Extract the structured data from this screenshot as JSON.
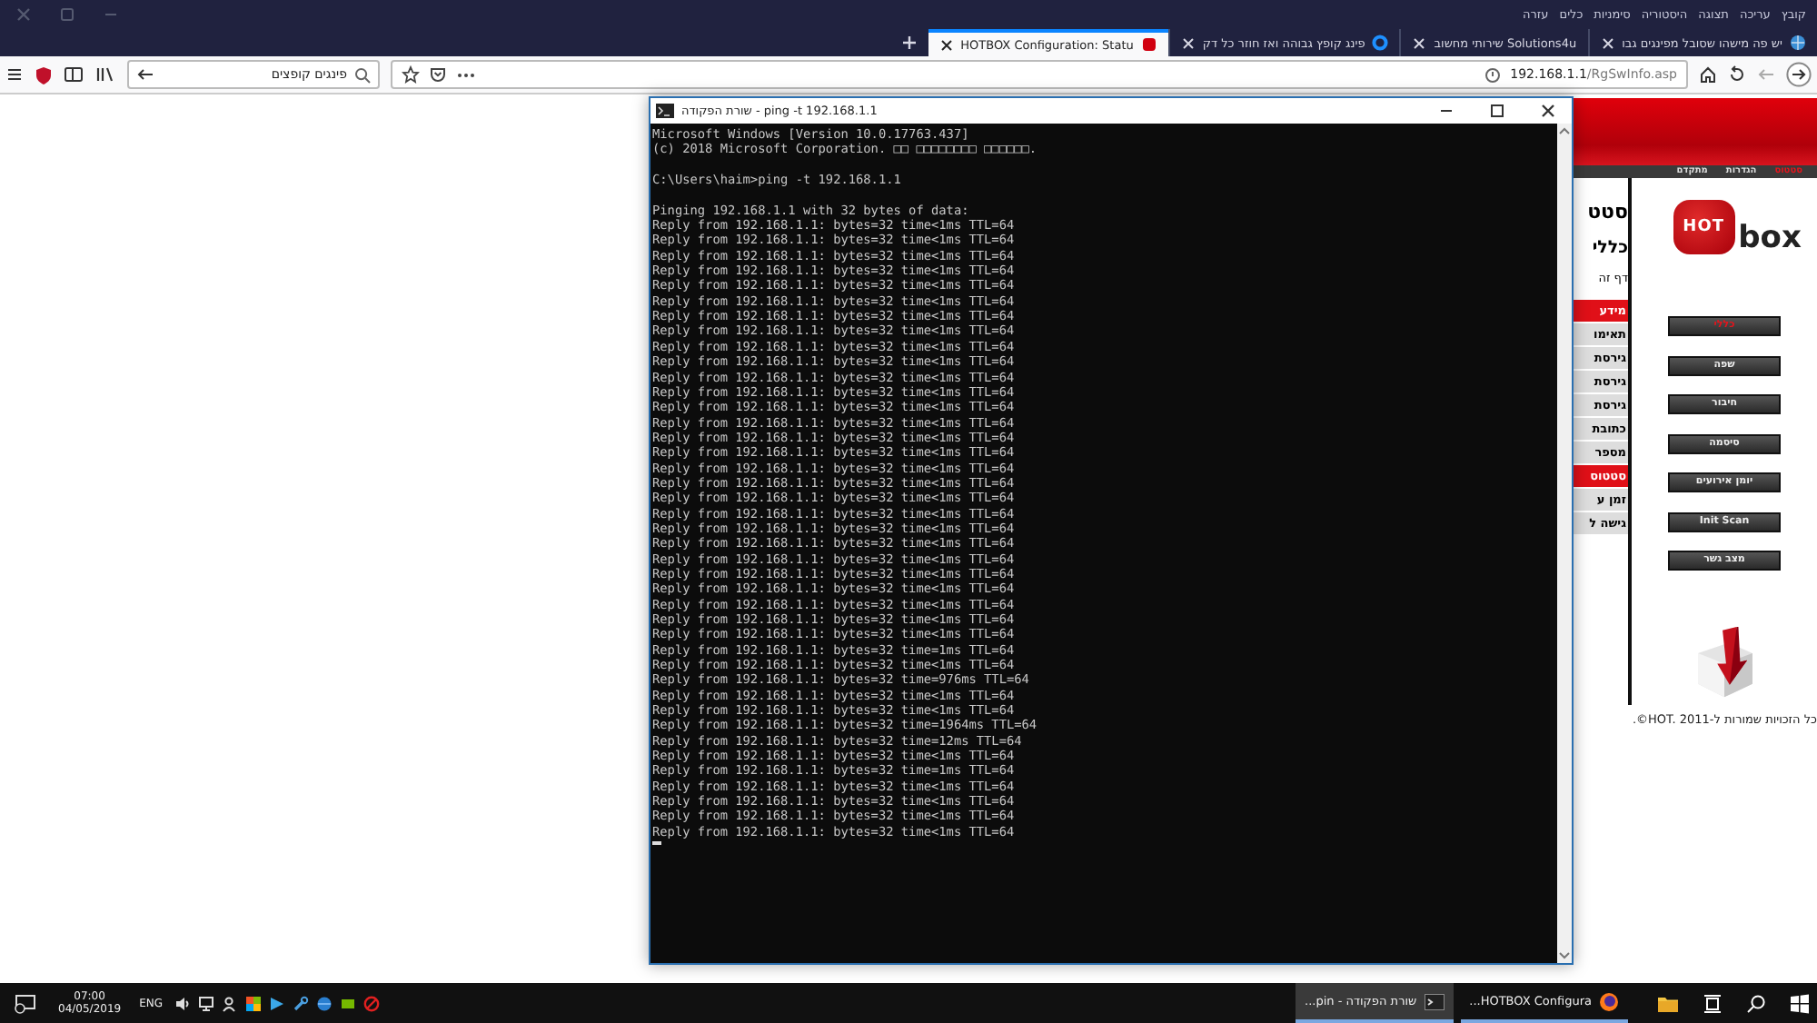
{
  "browser": {
    "menu": [
      "קובץ",
      "עריכה",
      "תצוגה",
      "היסטוריה",
      "סימניות",
      "כלים",
      "עזרה"
    ],
    "tabs": [
      {
        "title": "יש פה מישהו שסובל מפינגים גבו",
        "kind": "globe",
        "selected": false
      },
      {
        "title": "Solutions4u שירותי מחשוב",
        "kind": "none",
        "selected": false
      },
      {
        "title": "פינג קופץ גבוהה ואז חוזר כל דק",
        "kind": "ring",
        "selected": false
      },
      {
        "title": "HOTBOX Configuration: Statu",
        "kind": "square",
        "selected": true
      }
    ],
    "url_host": "192.168.1.1",
    "url_path": "/RgSwInfo.asp",
    "search": "פינגים קופצים"
  },
  "page": {
    "top_nav": [
      {
        "label": "סטטוס",
        "selected": true
      },
      {
        "label": "הגדרות",
        "selected": false
      },
      {
        "label": "מתקדם",
        "selected": false
      }
    ],
    "heading": "סטט",
    "subheading": "כללי",
    "intro": "דף זה",
    "table_rows": [
      {
        "label": "מידע",
        "highlighted": true
      },
      {
        "label": "תאימו",
        "highlighted": false
      },
      {
        "label": "גירסת",
        "highlighted": false
      },
      {
        "label": "גירסת",
        "highlighted": false
      },
      {
        "label": "גירסת",
        "highlighted": false
      },
      {
        "label": "כתובת",
        "highlighted": false
      },
      {
        "label": "מספר",
        "highlighted": false
      },
      {
        "label": "סטטוס",
        "highlighted": true
      },
      {
        "label": "זמן ע",
        "highlighted": false
      },
      {
        "label": "גישה ל",
        "highlighted": false
      }
    ],
    "logo": {
      "mark": "HOT",
      "word": "box"
    },
    "buttons": [
      {
        "label": "כללי",
        "selected": true
      },
      {
        "label": "שפה",
        "selected": false
      },
      {
        "label": "חיבור",
        "selected": false
      },
      {
        "label": "סיסמה",
        "selected": false
      },
      {
        "label": "יומן אירועים",
        "selected": false
      },
      {
        "label": "Init Scan",
        "selected": false
      },
      {
        "label": "מצב גשר",
        "selected": false
      }
    ],
    "footer": "כל הזכויות שמורות ל-HOT. 2011©."
  },
  "console": {
    "title": "שורת הפקודה - ping  -t 192.168.1.1",
    "blocks": [
      [
        "Microsoft Windows [Version 10.0.17763.437]",
        "(c) 2018 Microsoft Corporation. □□ □□□□□□□□ □□□□□□."
      ],
      [
        "C:\\Users\\haim>ping -t 192.168.1.1"
      ],
      [
        "Pinging 192.168.1.1 with 32 bytes of data:",
        "Reply from 192.168.1.1: bytes=32 time<1ms TTL=64",
        "Reply from 192.168.1.1: bytes=32 time<1ms TTL=64",
        "Reply from 192.168.1.1: bytes=32 time<1ms TTL=64",
        "Reply from 192.168.1.1: bytes=32 time<1ms TTL=64",
        "Reply from 192.168.1.1: bytes=32 time<1ms TTL=64",
        "Reply from 192.168.1.1: bytes=32 time<1ms TTL=64",
        "Reply from 192.168.1.1: bytes=32 time<1ms TTL=64",
        "Reply from 192.168.1.1: bytes=32 time<1ms TTL=64",
        "Reply from 192.168.1.1: bytes=32 time<1ms TTL=64",
        "Reply from 192.168.1.1: bytes=32 time<1ms TTL=64",
        "Reply from 192.168.1.1: bytes=32 time<1ms TTL=64",
        "Reply from 192.168.1.1: bytes=32 time<1ms TTL=64",
        "Reply from 192.168.1.1: bytes=32 time<1ms TTL=64",
        "Reply from 192.168.1.1: bytes=32 time<1ms TTL=64",
        "Reply from 192.168.1.1: bytes=32 time<1ms TTL=64",
        "Reply from 192.168.1.1: bytes=32 time<1ms TTL=64",
        "Reply from 192.168.1.1: bytes=32 time<1ms TTL=64",
        "Reply from 192.168.1.1: bytes=32 time<1ms TTL=64",
        "Reply from 192.168.1.1: bytes=32 time<1ms TTL=64",
        "Reply from 192.168.1.1: bytes=32 time<1ms TTL=64",
        "Reply from 192.168.1.1: bytes=32 time<1ms TTL=64",
        "Reply from 192.168.1.1: bytes=32 time<1ms TTL=64",
        "Reply from 192.168.1.1: bytes=32 time<1ms TTL=64",
        "Reply from 192.168.1.1: bytes=32 time<1ms TTL=64",
        "Reply from 192.168.1.1: bytes=32 time<1ms TTL=64",
        "Reply from 192.168.1.1: bytes=32 time<1ms TTL=64",
        "Reply from 192.168.1.1: bytes=32 time<1ms TTL=64",
        "Reply from 192.168.1.1: bytes=32 time<1ms TTL=64",
        "Reply from 192.168.1.1: bytes=32 time=1ms TTL=64",
        "Reply from 192.168.1.1: bytes=32 time<1ms TTL=64",
        "Reply from 192.168.1.1: bytes=32 time=976ms TTL=64",
        "Reply from 192.168.1.1: bytes=32 time<1ms TTL=64",
        "Reply from 192.168.1.1: bytes=32 time<1ms TTL=64",
        "Reply from 192.168.1.1: bytes=32 time=1964ms TTL=64",
        "Reply from 192.168.1.1: bytes=32 time=12ms TTL=64",
        "Reply from 192.168.1.1: bytes=32 time<1ms TTL=64",
        "Reply from 192.168.1.1: bytes=32 time=1ms TTL=64",
        "Reply from 192.168.1.1: bytes=32 time<1ms TTL=64",
        "Reply from 192.168.1.1: bytes=32 time<1ms TTL=64",
        "Reply from 192.168.1.1: bytes=32 time<1ms TTL=64",
        "Reply from 192.168.1.1: bytes=32 time<1ms TTL=64"
      ]
    ]
  },
  "taskbar": {
    "time": "07:00",
    "date": "04/05/2019",
    "language": "ENG",
    "tasks": [
      {
        "label": "HOTBOX Configura...",
        "kind": "browser",
        "selected": false
      },
      {
        "label": "שורת הפקודה - pin...",
        "kind": "console",
        "selected": true
      }
    ]
  }
}
